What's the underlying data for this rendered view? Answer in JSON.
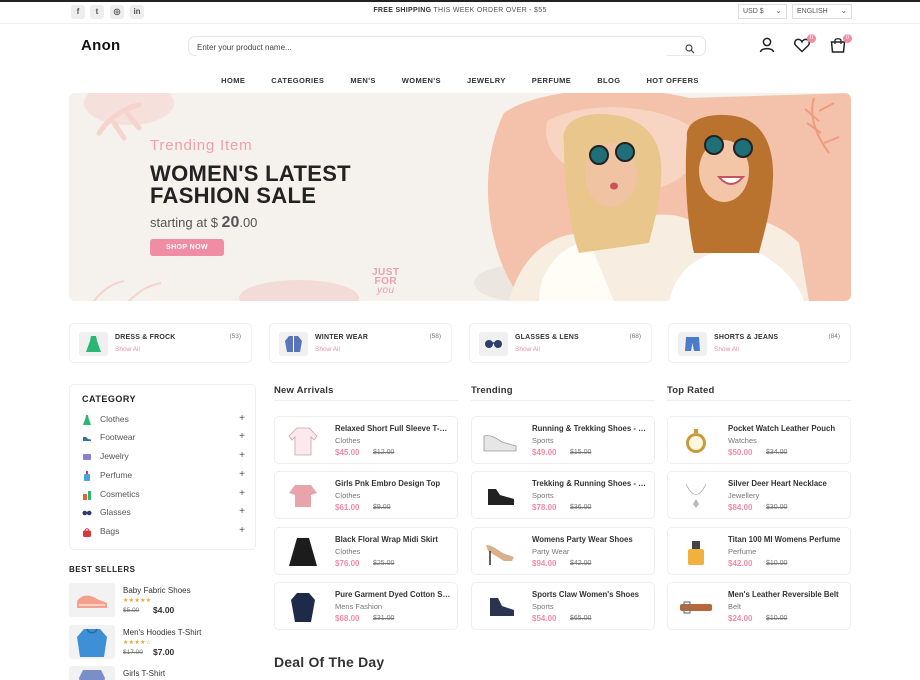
{
  "topbar": {
    "social": [
      {
        "name": "facebook-icon",
        "glyph": "f"
      },
      {
        "name": "twitter-icon",
        "glyph": "t"
      },
      {
        "name": "instagram-icon",
        "glyph": "◎"
      },
      {
        "name": "linkedin-icon",
        "glyph": "in"
      }
    ],
    "shipping_bold": "FREE SHIPPING",
    "shipping_rest": " THIS WEEK ORDER OVER - $55",
    "currency": "USD $",
    "language": "ENGLISH"
  },
  "header": {
    "logo": "Anon",
    "search_placeholder": "Enter your product name...",
    "wishlist_count": "0",
    "cart_count": "0"
  },
  "nav": [
    "HOME",
    "CATEGORIES",
    "MEN'S",
    "WOMEN'S",
    "JEWELRY",
    "PERFUME",
    "BLOG",
    "HOT OFFERS"
  ],
  "hero": {
    "subtitle": "Trending Item",
    "title_line1": "WOMEN'S LATEST",
    "title_line2": "FASHION SALE",
    "price_prefix": "starting at $ ",
    "price_main": "20",
    "price_cents": ".00",
    "button": "SHOP NOW",
    "stamp_line1": "JUST",
    "stamp_line2": "FOR",
    "stamp_line3": "you"
  },
  "categories": [
    {
      "title": "DRESS & FROCK",
      "count": "(53)",
      "link": "Show All",
      "icon": "dress-icon"
    },
    {
      "title": "WINTER WEAR",
      "count": "(58)",
      "link": "Show All",
      "icon": "coat-icon"
    },
    {
      "title": "GLASSES & LENS",
      "count": "(68)",
      "link": "Show All",
      "icon": "glasses-icon"
    },
    {
      "title": "SHORTS & JEANS",
      "count": "(84)",
      "link": "Show All",
      "icon": "shorts-icon"
    }
  ],
  "sidebar": {
    "title": "CATEGORY",
    "items": [
      {
        "label": "Clothes",
        "icon": "dress-icon",
        "color": "#2bb673"
      },
      {
        "label": "Footwear",
        "icon": "shoe-icon",
        "color": "#3a6ea5"
      },
      {
        "label": "Jewelry",
        "icon": "ring-icon",
        "color": "#8a7fd1"
      },
      {
        "label": "Perfume",
        "icon": "perfume-icon",
        "color": "#4aa3df"
      },
      {
        "label": "Cosmetics",
        "icon": "cosmetics-icon",
        "color": "#e6632e"
      },
      {
        "label": "Glasses",
        "icon": "glasses-icon",
        "color": "#2d3e6b"
      },
      {
        "label": "Bags",
        "icon": "bag-icon",
        "color": "#d9363e"
      }
    ]
  },
  "best_sellers": {
    "title": "BEST SELLERS",
    "items": [
      {
        "name": "Baby Fabric Shoes",
        "stars": "★★★★★",
        "old": "$5.00",
        "price": "$4.00"
      },
      {
        "name": "Men's Hoodies T-Shirt",
        "stars": "★★★★☆",
        "old": "$17.00",
        "price": "$7.00"
      },
      {
        "name": "Girls T-Shirt",
        "stars": "",
        "old": "",
        "price": ""
      }
    ]
  },
  "columns": [
    {
      "title": "New Arrivals",
      "products": [
        {
          "name": "Relaxed Short Full Sleeve T-Shirt",
          "category": "Clothes",
          "price": "$45.00",
          "old": "$12.00"
        },
        {
          "name": "Girls Pnk Embro Design Top",
          "category": "Clothes",
          "price": "$61.00",
          "old": "$9.00"
        },
        {
          "name": "Black Floral Wrap Midi Skirt",
          "category": "Clothes",
          "price": "$76.00",
          "old": "$25.00"
        },
        {
          "name": "Pure Garment Dyed Cotton Shirt",
          "category": "Mens Fashion",
          "price": "$68.00",
          "old": "$31.00"
        }
      ]
    },
    {
      "title": "Trending",
      "products": [
        {
          "name": "Running & Trekking Shoes - White",
          "category": "Sports",
          "price": "$49.00",
          "old": "$15.00"
        },
        {
          "name": "Trekking & Running Shoes - black",
          "category": "Sports",
          "price": "$78.00",
          "old": "$36.00"
        },
        {
          "name": "Womens Party Wear Shoes",
          "category": "Party Wear",
          "price": "$94.00",
          "old": "$42.00"
        },
        {
          "name": "Sports Claw Women's Shoes",
          "category": "Sports",
          "price": "$54.00",
          "old": "$65.00"
        }
      ]
    },
    {
      "title": "Top Rated",
      "products": [
        {
          "name": "Pocket Watch Leather Pouch",
          "category": "Watches",
          "price": "$50.00",
          "old": "$34.00"
        },
        {
          "name": "Silver Deer Heart Necklace",
          "category": "Jewellery",
          "price": "$84.00",
          "old": "$30.00"
        },
        {
          "name": "Titan 100 Ml Womens Perfume",
          "category": "Perfume",
          "price": "$42.00",
          "old": "$10.00"
        },
        {
          "name": "Men's Leather Reversible Belt",
          "category": "Belt",
          "price": "$24.00",
          "old": "$10.00"
        }
      ]
    }
  ],
  "deal_title": "Deal Of The Day",
  "colors": {
    "accent": "#f08ca4",
    "hero_bg": "#f5f1ec",
    "text": "#212121",
    "star": "#e9a13b"
  }
}
